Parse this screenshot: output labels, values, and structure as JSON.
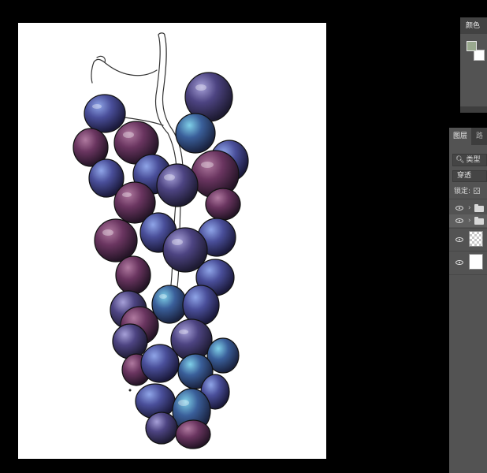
{
  "panels": {
    "color": {
      "tab_label": "颜色"
    },
    "layers": {
      "tab_layers": "图层",
      "tab_paths": "路",
      "filter_label": "类型",
      "blend_mode": "穿透",
      "lock_label": "锁定:"
    }
  },
  "layers_list": [
    {
      "type": "group",
      "visible": true
    },
    {
      "type": "group",
      "visible": true,
      "selected": true
    },
    {
      "type": "pixel",
      "visible": true,
      "thumbnail": "transparent"
    },
    {
      "type": "background",
      "visible": true,
      "thumbnail": "white"
    }
  ],
  "icons": [
    "eye-icon",
    "folder-icon",
    "search-icon",
    "lock-transparency-icon",
    "chevron-right-icon"
  ],
  "colors": {
    "foreground": "#9aa98f",
    "background": "#ffffff",
    "panel_bg": "#535353",
    "workspace_bg": "#000000",
    "canvas_bg": "#ffffff"
  }
}
